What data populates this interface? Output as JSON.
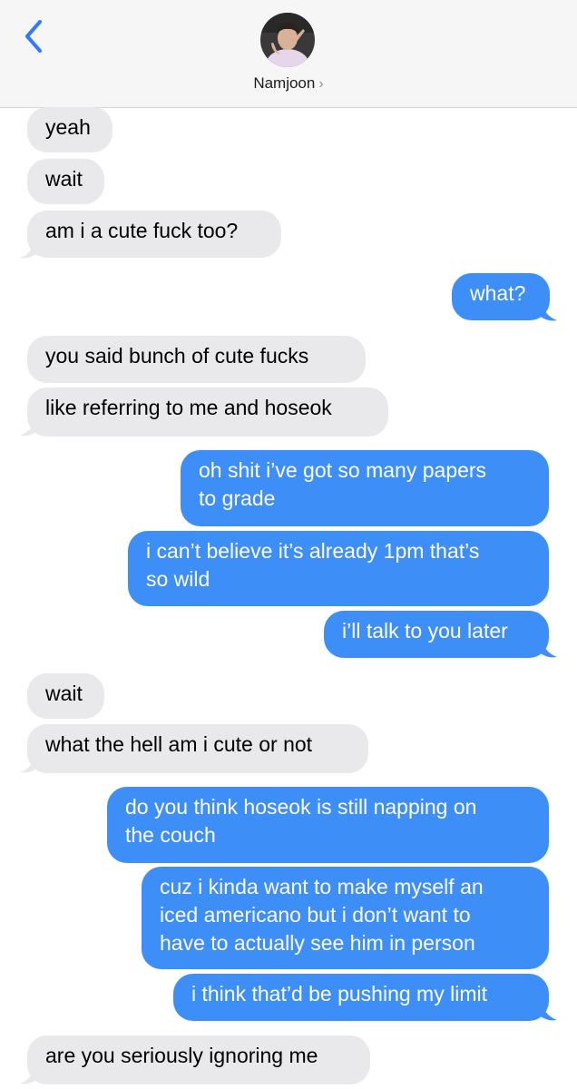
{
  "header": {
    "contact_name": "Namjoon",
    "chevron": "›",
    "back_icon": "chevron-left-icon"
  },
  "colors": {
    "incoming_bubble": "#e9e9eb",
    "outgoing_bubble": "#3e8ef7",
    "accent": "#3478f6"
  },
  "messages": [
    {
      "dir": "in",
      "lines": [
        "yeah"
      ]
    },
    {
      "dir": "in",
      "lines": [
        "wait"
      ]
    },
    {
      "dir": "in",
      "lines": [
        "am i a cute fuck too?"
      ]
    },
    {
      "dir": "out",
      "lines": [
        "what?"
      ]
    },
    {
      "dir": "in",
      "lines": [
        "you said bunch of cute fucks"
      ]
    },
    {
      "dir": "in",
      "lines": [
        "like referring to me and hoseok"
      ]
    },
    {
      "dir": "out",
      "lines": [
        "oh shit i’ve got so many papers",
        "to grade"
      ]
    },
    {
      "dir": "out",
      "lines": [
        "i can’t believe it’s already 1pm that’s",
        "so wild"
      ]
    },
    {
      "dir": "out",
      "lines": [
        "i’ll talk to you later"
      ]
    },
    {
      "dir": "in",
      "lines": [
        "wait"
      ]
    },
    {
      "dir": "in",
      "lines": [
        "what the hell am i cute or not"
      ]
    },
    {
      "dir": "out",
      "lines": [
        "do you think hoseok is still napping on",
        "the couch"
      ]
    },
    {
      "dir": "out",
      "lines": [
        "cuz i kinda want to make myself an",
        "iced americano but i don’t want to",
        "have to actually see him in person"
      ]
    },
    {
      "dir": "out",
      "lines": [
        "i think that’d be pushing my limit"
      ]
    },
    {
      "dir": "in",
      "lines": [
        "are you seriously ignoring me"
      ]
    }
  ]
}
